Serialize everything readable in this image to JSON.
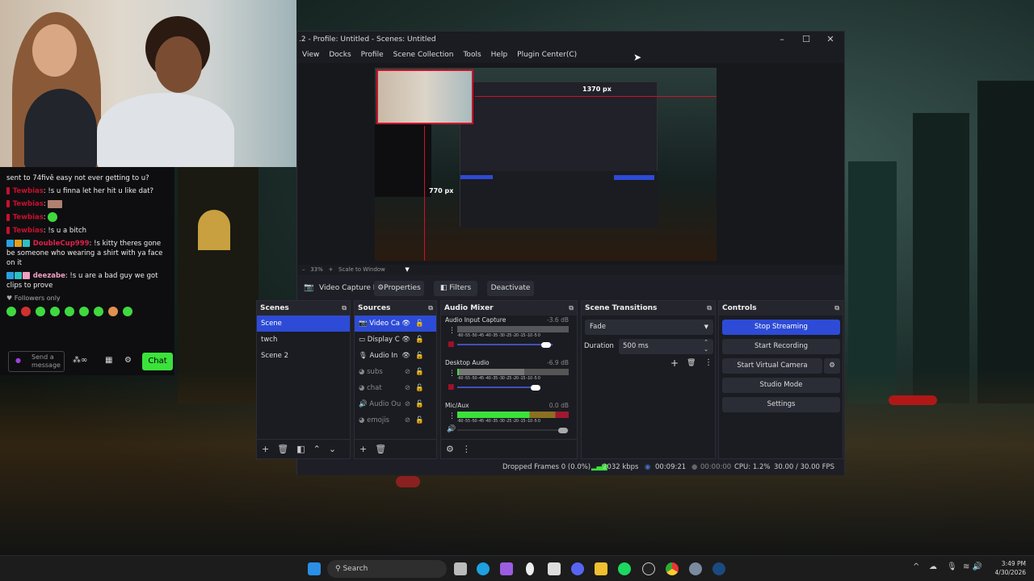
{
  "obs": {
    "title": ".2 - Profile: Untitled - Scenes: Untitled",
    "menu": [
      "View",
      "Docks",
      "Profile",
      "Scene Collection",
      "Tools",
      "Help",
      "Plugin Center(C)"
    ],
    "preview": {
      "zoom": "33%",
      "scale_mode": "Scale to Window",
      "ruler_h": "1370 px",
      "ruler_v": "770 px"
    },
    "source_bar": {
      "selected_source": "Video Capture Device",
      "properties": "Properties",
      "filters": "Filters",
      "deactivate": "Deactivate"
    },
    "scenes": {
      "title": "Scenes",
      "items": [
        "Scene",
        "twch",
        "Scene 2"
      ],
      "selected": "Scene"
    },
    "sources": {
      "title": "Sources",
      "items": [
        {
          "name": "Video Ca",
          "icon": "camera-icon",
          "visible": true
        },
        {
          "name": "Display C",
          "icon": "monitor-icon",
          "visible": true
        },
        {
          "name": "Audio In",
          "icon": "mic-icon",
          "visible": true
        },
        {
          "name": "subs",
          "icon": "globe-icon",
          "visible": false
        },
        {
          "name": "chat",
          "icon": "globe-icon",
          "visible": false
        },
        {
          "name": "Audio Ou",
          "icon": "speaker-icon",
          "visible": false
        },
        {
          "name": "emojis",
          "icon": "globe-icon",
          "visible": false
        }
      ]
    },
    "audio_mixer": {
      "title": "Audio Mixer",
      "scale": "-60 -55 -50 -45 -40 -35 -30 -25 -20 -15 -10 -5 0",
      "channels": [
        {
          "name": "Audio Input Capture",
          "db": "-3.6 dB",
          "muted": true,
          "volume": 0.9
        },
        {
          "name": "Desktop Audio",
          "db": "-6.9 dB",
          "muted": true,
          "volume": 0.8
        },
        {
          "name": "Mic/Aux",
          "db": "0.0 dB",
          "muted": false,
          "volume": 1.0
        }
      ]
    },
    "transitions": {
      "title": "Scene Transitions",
      "type": "Fade",
      "duration_label": "Duration",
      "duration": "500 ms"
    },
    "controls": {
      "title": "Controls",
      "stop_streaming": "Stop Streaming",
      "start_recording": "Start Recording",
      "start_virtual_camera": "Start Virtual Camera",
      "studio_mode": "Studio Mode",
      "settings": "Settings"
    },
    "status": {
      "dropped": "Dropped Frames 0 (0.0%)",
      "bitrate": "2032 kbps",
      "stream_time": "00:09:21",
      "rec_time": "00:00:00",
      "cpu": "CPU: 1.2%",
      "fps": "30.00 / 30.00 FPS"
    },
    "accent": "#2d4bd6"
  },
  "chat": {
    "messages": [
      {
        "user": "",
        "text": "sent to 74fivê easy not ever getting to u?"
      },
      {
        "user": "Tewbias",
        "text": ": !s u finna let her hit u like dat?"
      },
      {
        "user": "Tewbias",
        "text": ":"
      },
      {
        "user": "Tewbias",
        "text": ":"
      },
      {
        "user": "Tewbias",
        "text": ": !s u a bitch"
      },
      {
        "user": "DoubleCup999",
        "text": ": !s kitty theres gone be someone who wearing a shirt with ya face on it"
      },
      {
        "user": "deezabe",
        "text": ": !s u are a bad guy we got clips to prove"
      }
    ],
    "followers_only": "Followers only",
    "input_placeholder": "Send a message",
    "chat_button": "Chat",
    "chat_button_color": "#3be23b"
  },
  "taskbar": {
    "search": "Search",
    "time": "3:49 PM",
    "date": "4/30/2026"
  }
}
